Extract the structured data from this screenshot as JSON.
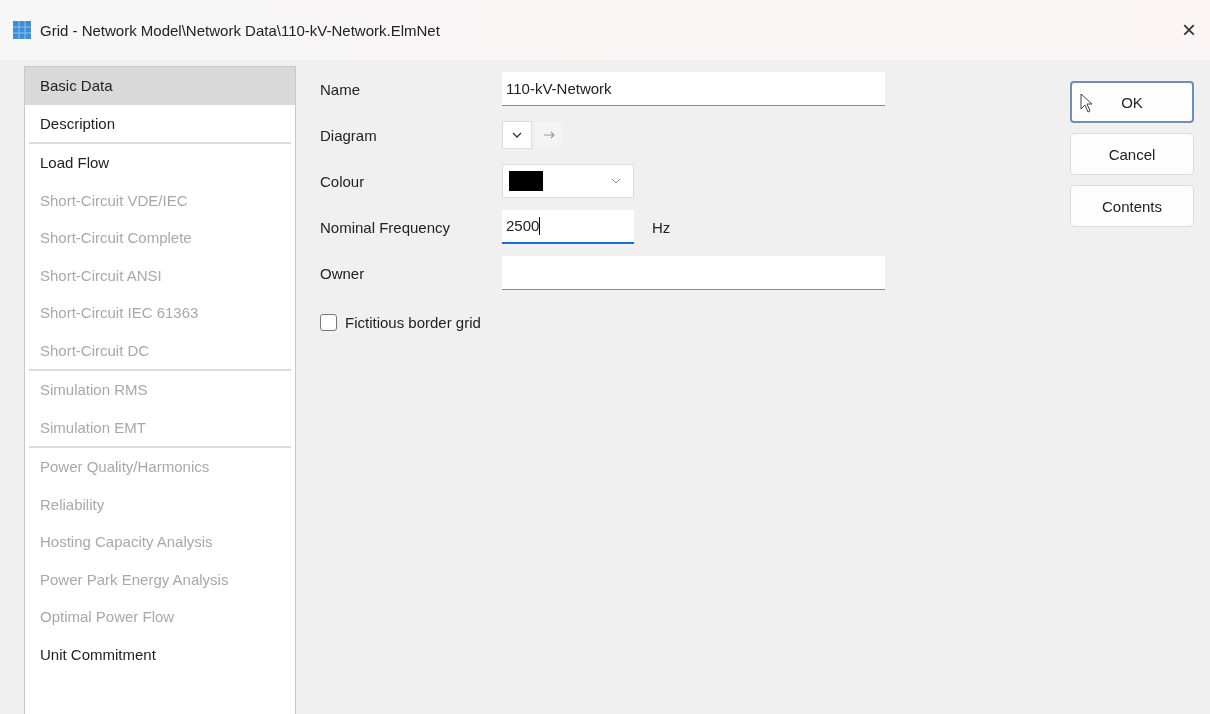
{
  "window": {
    "title": "Grid - Network Model\\Network Data\\110-kV-Network.ElmNet",
    "close": "×"
  },
  "sidebar": {
    "groups": [
      {
        "items": [
          {
            "label": "Basic Data",
            "selected": true,
            "disabled": false
          },
          {
            "label": "Description",
            "selected": false,
            "disabled": false
          }
        ]
      },
      {
        "items": [
          {
            "label": "Load Flow",
            "selected": false,
            "disabled": false
          },
          {
            "label": "Short-Circuit VDE/IEC",
            "selected": false,
            "disabled": true
          },
          {
            "label": "Short-Circuit Complete",
            "selected": false,
            "disabled": true
          },
          {
            "label": "Short-Circuit ANSI",
            "selected": false,
            "disabled": true
          },
          {
            "label": "Short-Circuit IEC 61363",
            "selected": false,
            "disabled": true
          },
          {
            "label": "Short-Circuit DC",
            "selected": false,
            "disabled": true
          }
        ]
      },
      {
        "items": [
          {
            "label": "Simulation RMS",
            "selected": false,
            "disabled": true
          },
          {
            "label": "Simulation EMT",
            "selected": false,
            "disabled": true
          }
        ]
      },
      {
        "items": [
          {
            "label": "Power Quality/Harmonics",
            "selected": false,
            "disabled": true
          },
          {
            "label": "Reliability",
            "selected": false,
            "disabled": true
          },
          {
            "label": "Hosting Capacity Analysis",
            "selected": false,
            "disabled": true
          },
          {
            "label": "Power Park Energy Analysis",
            "selected": false,
            "disabled": true
          },
          {
            "label": "Optimal Power Flow",
            "selected": false,
            "disabled": true
          },
          {
            "label": "Unit Commitment",
            "selected": false,
            "disabled": false
          }
        ]
      }
    ]
  },
  "form": {
    "fields": [
      {
        "kind": "text",
        "label": "Name",
        "value": "110-kV-Network",
        "focused": false
      },
      {
        "kind": "diagram",
        "label": "Diagram"
      },
      {
        "kind": "color",
        "label": "Colour",
        "color": "#000000"
      },
      {
        "kind": "short",
        "label": "Nominal Frequency",
        "value": "2500",
        "unit": "Hz",
        "focused": true
      },
      {
        "kind": "text",
        "label": "Owner",
        "focused": false
      }
    ],
    "checkbox": {
      "label": "Fictitious border grid",
      "checked": false
    }
  },
  "buttons": [
    {
      "label": "OK",
      "default": true
    },
    {
      "label": "Cancel",
      "default": false
    },
    {
      "label": "Contents",
      "default": false
    }
  ]
}
